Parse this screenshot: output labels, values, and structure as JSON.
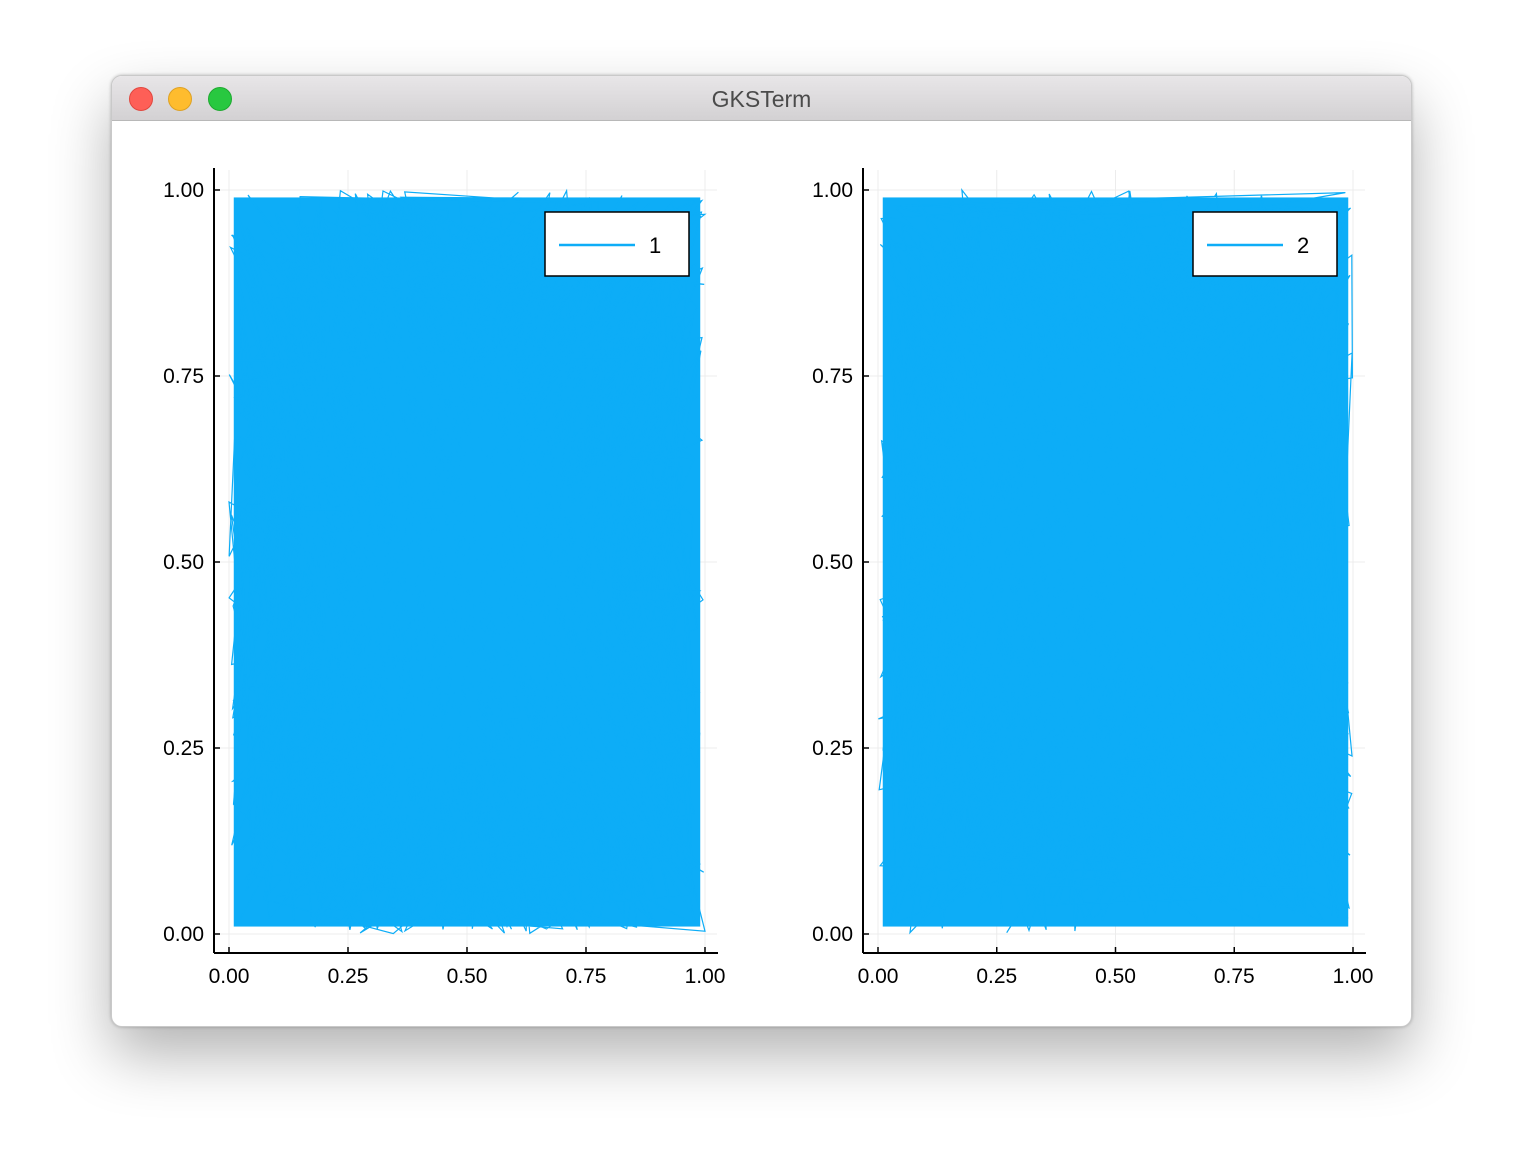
{
  "window": {
    "title": "GKSTerm"
  },
  "colors": {
    "series": "#0dadf7",
    "axis": "#000000",
    "grid": "#ececec",
    "legend_border": "#000000"
  },
  "chart_data": [
    {
      "type": "line",
      "series": [
        {
          "name": "1",
          "x_range": [
            0.0,
            1.0
          ],
          "y_range": [
            0.0,
            1.0
          ],
          "description_values": "dense random walk of uniform random points in [0,1]x[0,1]"
        }
      ],
      "xlim": [
        -0.03,
        1.03
      ],
      "ylim": [
        -0.03,
        1.03
      ],
      "xticks": [
        0.0,
        0.25,
        0.5,
        0.75,
        1.0
      ],
      "yticks": [
        0.0,
        0.25,
        0.5,
        0.75,
        1.0
      ],
      "xtick_labels": [
        "0.00",
        "0.25",
        "0.50",
        "0.75",
        "1.00"
      ],
      "ytick_labels": [
        "0.00",
        "0.25",
        "0.50",
        "0.75",
        "1.00"
      ],
      "title": "",
      "xlabel": "",
      "ylabel": "",
      "grid": true,
      "legend_position": "top-right"
    },
    {
      "type": "line",
      "series": [
        {
          "name": "2",
          "x_range": [
            0.0,
            1.0
          ],
          "y_range": [
            0.0,
            1.0
          ],
          "description_values": "dense random walk of uniform random points in [0,1]x[0,1]"
        }
      ],
      "xlim": [
        -0.03,
        1.03
      ],
      "ylim": [
        -0.03,
        1.03
      ],
      "xticks": [
        0.0,
        0.25,
        0.5,
        0.75,
        1.0
      ],
      "yticks": [
        0.0,
        0.25,
        0.5,
        0.75,
        1.0
      ],
      "xtick_labels": [
        "0.00",
        "0.25",
        "0.50",
        "0.75",
        "1.00"
      ],
      "ytick_labels": [
        "0.00",
        "0.25",
        "0.50",
        "0.75",
        "1.00"
      ],
      "title": "",
      "xlabel": "",
      "ylabel": "",
      "grid": true,
      "legend_position": "top-right"
    }
  ]
}
